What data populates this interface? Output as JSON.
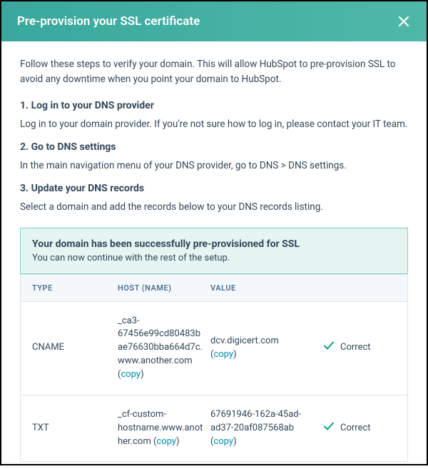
{
  "header": {
    "title": "Pre-provision your SSL certificate"
  },
  "intro": "Follow these steps to verify your domain. This will allow HubSpot to pre-provision SSL to avoid any downtime when you point your domain to HubSpot.",
  "steps": [
    {
      "heading": "1.  Log in to your DNS provider",
      "body": "Log in to your domain provider. If you're not sure how to log in, please contact your IT team."
    },
    {
      "heading": "2.  Go to DNS settings",
      "body": "In the main navigation menu of your DNS provider, go to DNS > DNS settings."
    },
    {
      "heading": "3.  Update your DNS records",
      "body": "Select a domain and add the records below to your DNS records listing."
    }
  ],
  "success": {
    "title": "Your domain has been successfully pre-provisioned for SSL",
    "sub": "You can now continue with the rest of the setup."
  },
  "table": {
    "headers": {
      "type": "TYPE",
      "host": "HOST (NAME)",
      "value": "VALUE"
    },
    "copy_label": "copy",
    "status_label": "Correct",
    "rows": [
      {
        "type": "CNAME",
        "host": "_ca3-67456e99cd80483bae76630bba664d7c.www.another.com",
        "value": "dcv.digicert.com"
      },
      {
        "type": "TXT",
        "host": "_cf-custom-hostname.www.another.com",
        "value": "67691946-162a-45ad-ad37-20af087568ab"
      }
    ]
  }
}
